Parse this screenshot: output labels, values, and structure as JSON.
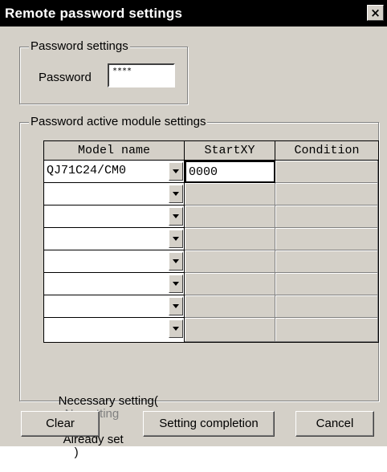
{
  "window": {
    "title": "Remote password settings",
    "close_glyph": "×"
  },
  "password_group": {
    "label": "Password settings",
    "field_label": "Password",
    "value": "****"
  },
  "module_group": {
    "label": "Password active module settings",
    "columns": [
      "Model name",
      "StartXY",
      "Condition"
    ],
    "rows": [
      {
        "model": "QJ71C24/CM0",
        "startxy": "0000",
        "condition": ""
      },
      {
        "model": "",
        "startxy": "",
        "condition": ""
      },
      {
        "model": "",
        "startxy": "",
        "condition": ""
      },
      {
        "model": "",
        "startxy": "",
        "condition": ""
      },
      {
        "model": "",
        "startxy": "",
        "condition": ""
      },
      {
        "model": "",
        "startxy": "",
        "condition": ""
      },
      {
        "model": "",
        "startxy": "",
        "condition": ""
      },
      {
        "model": "",
        "startxy": "",
        "condition": ""
      }
    ],
    "legend": {
      "prefix": "Necessary setting(",
      "no_setting": "No setting",
      "separator": "/",
      "already_set": "Already set",
      "suffix": ")"
    }
  },
  "buttons": {
    "clear": "Clear",
    "setting_completion": "Setting completion",
    "cancel": "Cancel"
  }
}
